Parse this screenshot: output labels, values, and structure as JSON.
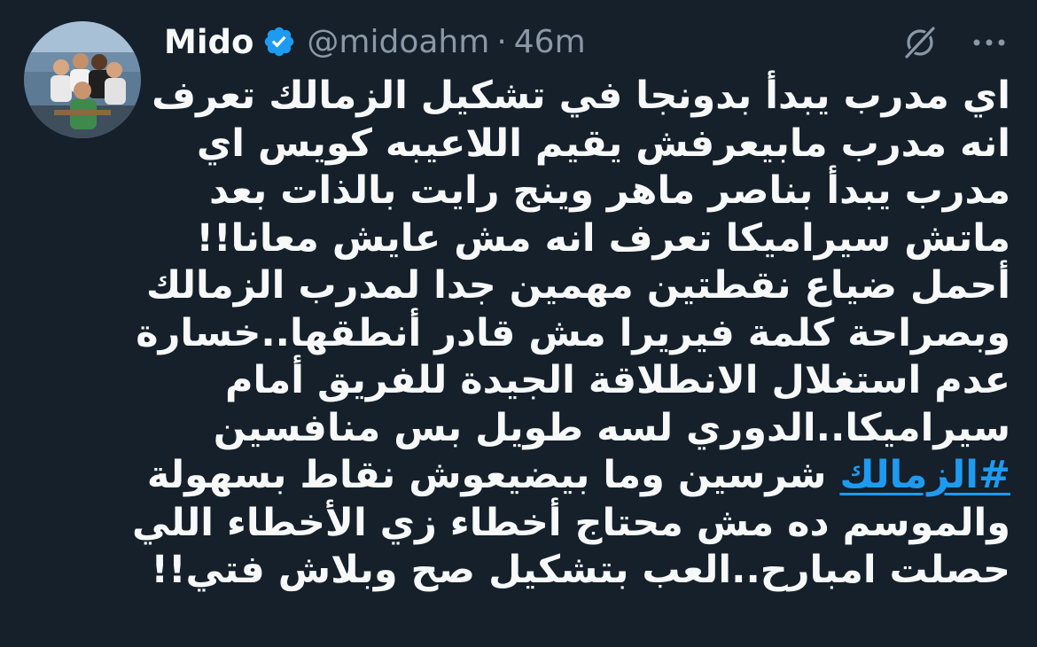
{
  "user": {
    "display_name": "Mido",
    "handle": "@midoahm",
    "separator": "·",
    "time_ago": "46m",
    "verified_icon": "verified-badge-icon",
    "avatar_icon": "profile-photo"
  },
  "actions": {
    "grok_icon": "grok-icon",
    "more_icon": "more-options-icon"
  },
  "tweet": {
    "lines": [
      "اي مدرب يبدأ بدونجا في تشكيل الزمالك تعرف",
      "انه مدرب مابيعرفش يقيم اللاعيبه كويس اي",
      "مدرب يبدأ بناصر ماهر وينج رايت بالذات بعد",
      "ماتش سيراميكا تعرف انه مش عايش معانا!!",
      "أحمل ضياع نقطتين مهمين جدا لمدرب الزمالك",
      "وبصراحة كلمة فيريرا مش قادر أنطقها..خسارة",
      "عدم استغلال الانطلاقة الجيدة للفريق أمام",
      "سيراميكا..الدوري لسه طويل بس منافسين"
    ],
    "hashtag": "#الزمالك",
    "hashtag_line_rest": " شرسين وما بيضيعوش نقاط بسهولة",
    "lines_after": [
      "والموسم ده مش محتاج أخطاء زي الأخطاء اللي",
      "حصلت امبارح..العب بتشكيل صح وبلاش فتي!!"
    ]
  },
  "colors": {
    "background": "#15202b",
    "text": "#f7f9f9",
    "secondary": "#8b98a5",
    "accent": "#1d9bf0"
  }
}
